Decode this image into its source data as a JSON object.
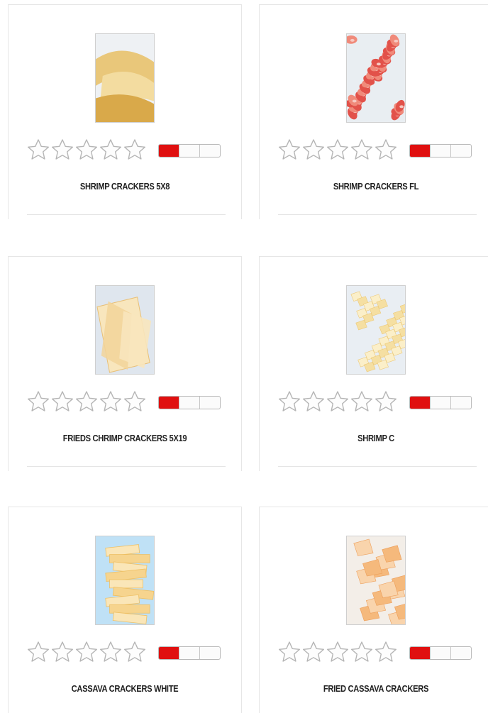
{
  "products": [
    {
      "name": "SHRIMP CRACKERS 5X8",
      "rating": 0,
      "max_rating": 5,
      "level": 0.33,
      "image_icon": "product-photo-shrimp-crackers"
    },
    {
      "name": "SHRIMP CRACKERS FL",
      "rating": 0,
      "max_rating": 5,
      "level": 0.33,
      "image_icon": "product-photo-shrimp-crackers-red"
    },
    {
      "name": "FRIEDS CHRIMP CRACKERS 5X19",
      "rating": 0,
      "max_rating": 5,
      "level": 0.33,
      "image_icon": "product-photo-fried-shrimp-crackers"
    },
    {
      "name": "SHRIMP C",
      "rating": 0,
      "max_rating": 5,
      "level": 0.33,
      "image_icon": "product-photo-shrimp-chips"
    },
    {
      "name": "CASSAVA CRACKERS WHITE",
      "rating": 0,
      "max_rating": 5,
      "level": 0.33,
      "image_icon": "product-photo-cassava-crackers-white"
    },
    {
      "name": "FRIED CASSAVA CRACKERS",
      "rating": 0,
      "max_rating": 5,
      "level": 0.33,
      "image_icon": "product-photo-fried-cassava-crackers"
    }
  ],
  "colors": {
    "meter_fill": "#e01010",
    "star_outline": "#b5b5b5",
    "title_text": "#222222"
  }
}
